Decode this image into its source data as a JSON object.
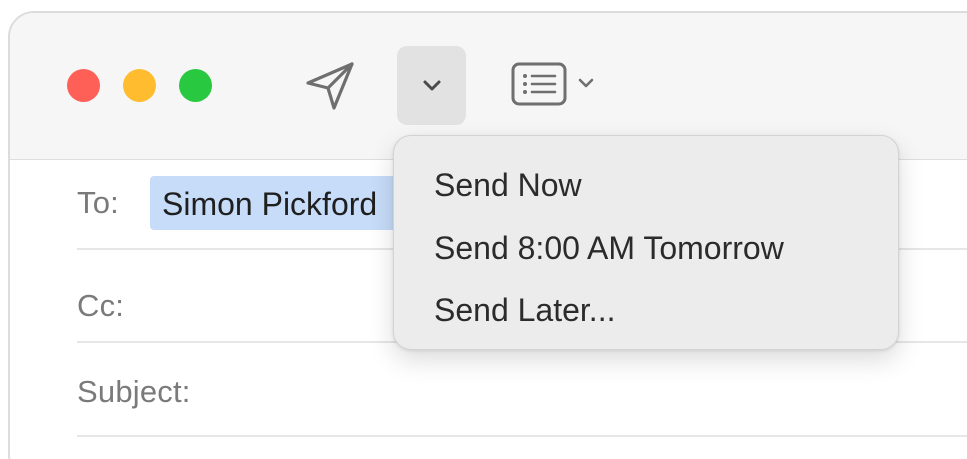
{
  "window_controls": {
    "close_color": "#fe5f57",
    "minimize_color": "#febc2e",
    "zoom_color": "#28c840"
  },
  "toolbar": {
    "send_icon": "paper-plane-icon",
    "send_options_icon": "chevron-down-icon",
    "format_icon": "format-bar-icon"
  },
  "fields": {
    "to_label": "To:",
    "to_recipient": "Simon Pickford",
    "cc_label": "Cc:",
    "subject_label": "Subject:"
  },
  "send_menu": {
    "items": [
      {
        "label": "Send Now"
      },
      {
        "label": "Send 8:00 AM Tomorrow"
      },
      {
        "label": "Send Later..."
      }
    ]
  },
  "colors": {
    "recipient_highlight": "#c6dcf8",
    "menu_background": "#ececec"
  }
}
